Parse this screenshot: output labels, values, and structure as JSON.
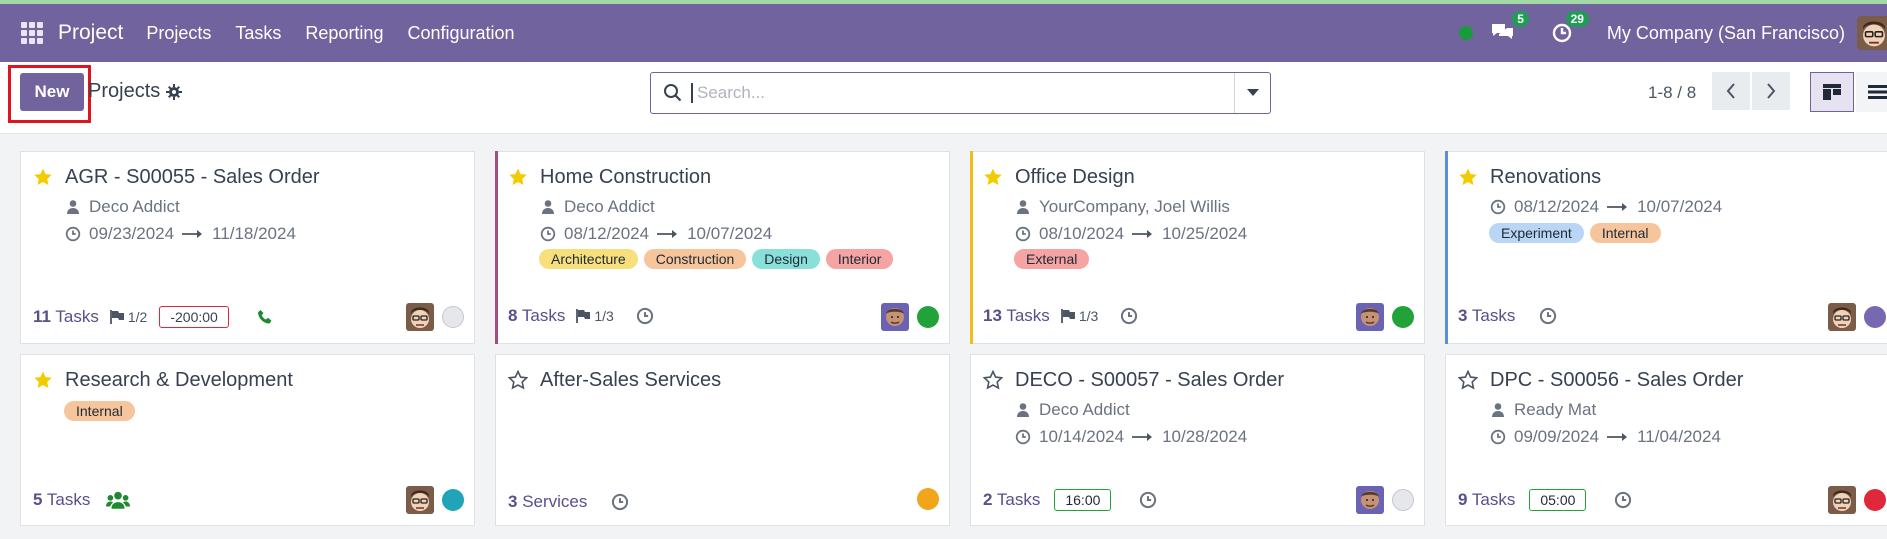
{
  "app": {
    "name": "Project"
  },
  "nav": {
    "menu": [
      "Projects",
      "Tasks",
      "Reporting",
      "Configuration"
    ],
    "messages_count": "5",
    "activities_count": "29",
    "company": "My Company (San Francisco)"
  },
  "control": {
    "new_label": "New",
    "breadcrumb": "Projects",
    "search_placeholder": "Search...",
    "pager": "1-8 / 8"
  },
  "colors": {
    "brand": "#71639e",
    "tag_architecture": "#f7e07b",
    "tag_construction": "#f7c59b",
    "tag_design": "#88e0d8",
    "tag_interior": "#f5a3a3",
    "tag_external": "#f5a3a3",
    "tag_experiment": "#b9d6f5",
    "tag_internal": "#f7c59b",
    "status_green": "#21a33a",
    "status_grey": "#e5e7eb",
    "status_purple": "#7868b0",
    "status_teal": "#21a3b8",
    "status_orange": "#f0a51a",
    "status_red": "#e0283c"
  },
  "projects": [
    {
      "name": "AGR - S00055 - Sales Order",
      "favorite": true,
      "customer": "Deco Addict",
      "start": "09/23/2024",
      "end": "11/18/2024",
      "tags": [],
      "count": "11",
      "count_label": "Tasks",
      "milestones": "1/2",
      "chip": "-200:00",
      "status": "grey"
    },
    {
      "name": "Home Construction",
      "favorite": true,
      "customer": "Deco Addict",
      "start": "08/12/2024",
      "end": "10/07/2024",
      "tags": [
        "Architecture",
        "Construction",
        "Design",
        "Interior"
      ],
      "count": "8",
      "count_label": "Tasks",
      "milestones": "1/3",
      "status": "green"
    },
    {
      "name": "Office Design",
      "favorite": true,
      "customer": "YourCompany, Joel Willis",
      "start": "08/10/2024",
      "end": "10/25/2024",
      "tags": [
        "External"
      ],
      "count": "13",
      "count_label": "Tasks",
      "milestones": "1/3",
      "status": "green"
    },
    {
      "name": "Renovations",
      "favorite": true,
      "start": "08/12/2024",
      "end": "10/07/2024",
      "tags": [
        "Experiment",
        "Internal"
      ],
      "count": "3",
      "count_label": "Tasks",
      "status": "purple"
    },
    {
      "name": "Research & Development",
      "favorite": true,
      "tags": [
        "Internal"
      ],
      "count": "5",
      "count_label": "Tasks",
      "status": "teal"
    },
    {
      "name": "After-Sales Services",
      "favorite": false,
      "tags": [],
      "count": "3",
      "count_label": "Services",
      "status": "orange"
    },
    {
      "name": "DECO - S00057 - Sales Order",
      "favorite": false,
      "customer": "Deco Addict",
      "start": "10/14/2024",
      "end": "10/28/2024",
      "tags": [],
      "count": "2",
      "count_label": "Tasks",
      "chip": "16:00",
      "status": "grey"
    },
    {
      "name": "DPC - S00056 - Sales Order",
      "favorite": false,
      "customer": "Ready Mat",
      "start": "09/09/2024",
      "end": "11/04/2024",
      "tags": [],
      "count": "9",
      "count_label": "Tasks",
      "chip": "05:00",
      "status": "red"
    }
  ]
}
